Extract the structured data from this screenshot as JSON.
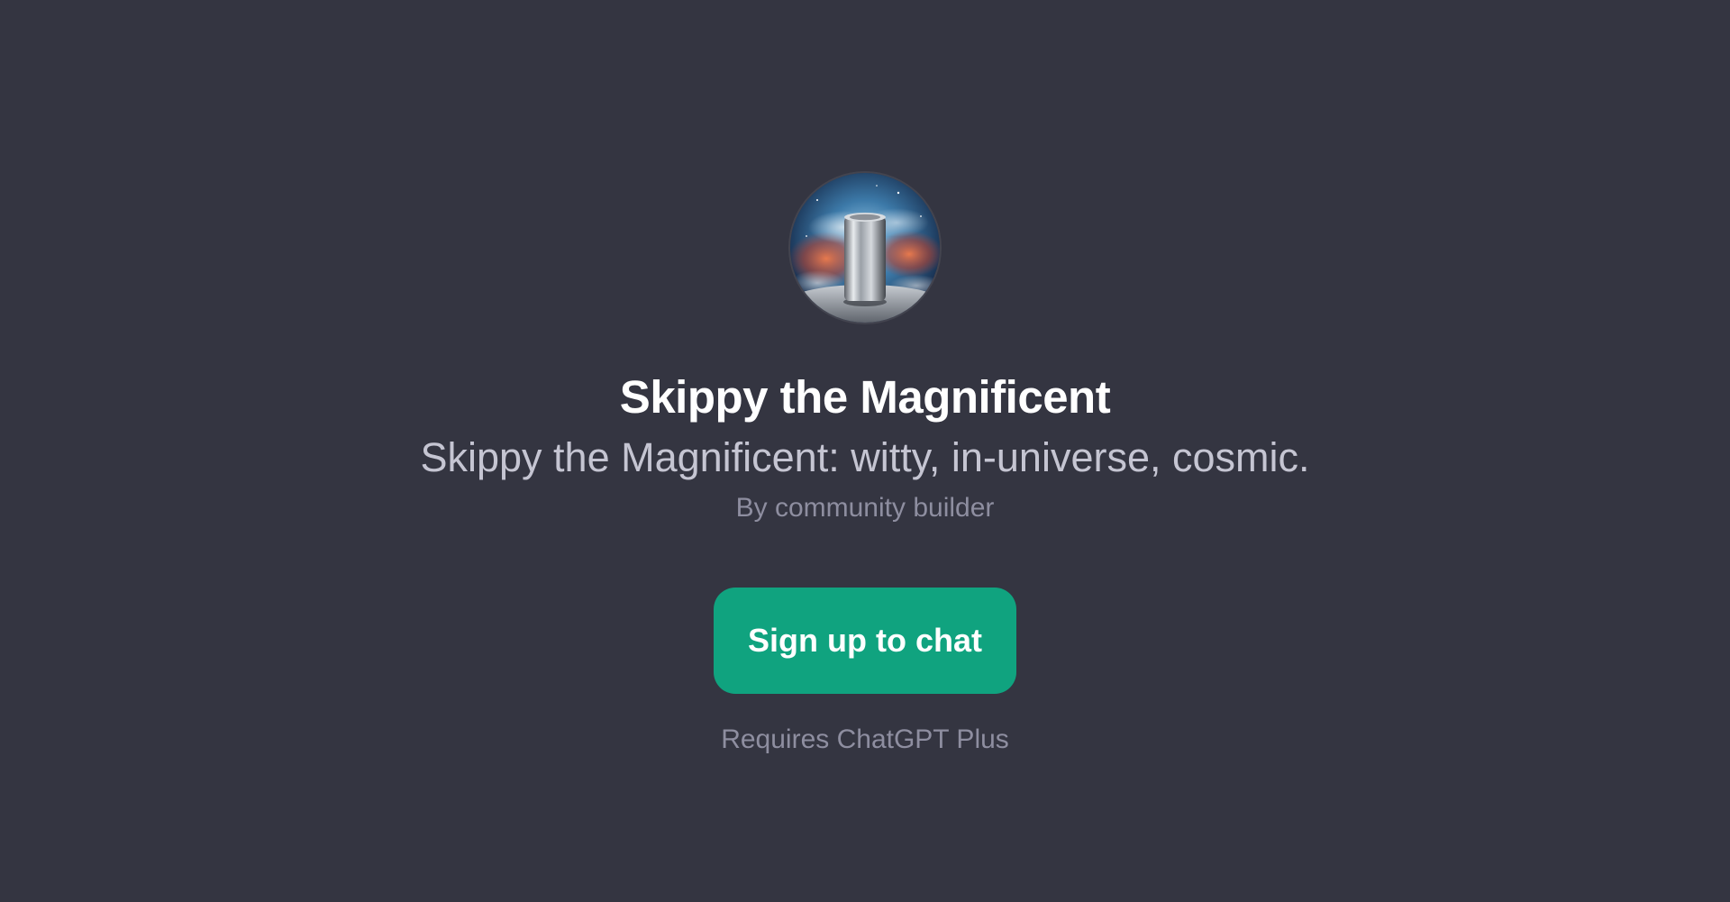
{
  "gpt": {
    "name": "Skippy the Magnificent",
    "description": "Skippy the Magnificent: witty, in-universe, cosmic.",
    "author": "By community builder",
    "avatar_icon": "cosmic-beer-can-avatar"
  },
  "actions": {
    "signup_label": "Sign up to chat",
    "requirement_note": "Requires ChatGPT Plus"
  },
  "colors": {
    "background": "#343541",
    "title": "#ffffff",
    "description": "#c5c5d2",
    "muted": "#8e8ea0",
    "accent": "#10a37f"
  }
}
